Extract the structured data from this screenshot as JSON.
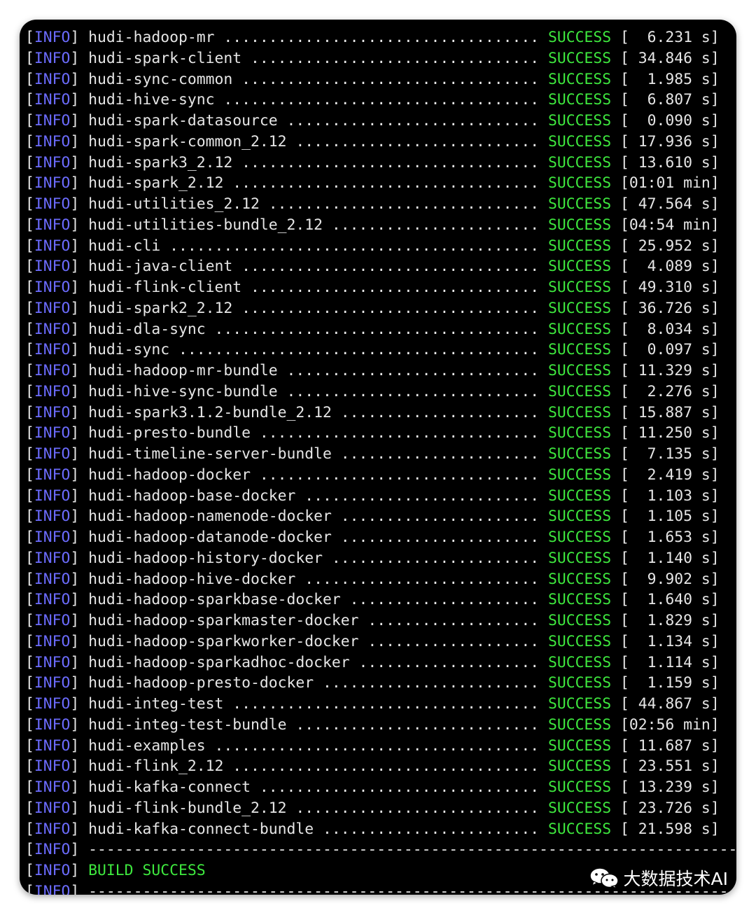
{
  "log": {
    "tag": "INFO",
    "status": "SUCCESS",
    "rows": [
      {
        "module": "hudi-hadoop-mr",
        "time": "  6.231 s"
      },
      {
        "module": "hudi-spark-client",
        "time": " 34.846 s"
      },
      {
        "module": "hudi-sync-common",
        "time": "  1.985 s"
      },
      {
        "module": "hudi-hive-sync",
        "time": "  6.807 s"
      },
      {
        "module": "hudi-spark-datasource",
        "time": "  0.090 s"
      },
      {
        "module": "hudi-spark-common_2.12",
        "time": " 17.936 s"
      },
      {
        "module": "hudi-spark3_2.12",
        "time": " 13.610 s"
      },
      {
        "module": "hudi-spark_2.12",
        "time": "01:01 min"
      },
      {
        "module": "hudi-utilities_2.12",
        "time": " 47.564 s"
      },
      {
        "module": "hudi-utilities-bundle_2.12",
        "time": "04:54 min"
      },
      {
        "module": "hudi-cli",
        "time": " 25.952 s"
      },
      {
        "module": "hudi-java-client",
        "time": "  4.089 s"
      },
      {
        "module": "hudi-flink-client",
        "time": " 49.310 s"
      },
      {
        "module": "hudi-spark2_2.12",
        "time": " 36.726 s"
      },
      {
        "module": "hudi-dla-sync",
        "time": "  8.034 s"
      },
      {
        "module": "hudi-sync",
        "time": "  0.097 s"
      },
      {
        "module": "hudi-hadoop-mr-bundle",
        "time": " 11.329 s"
      },
      {
        "module": "hudi-hive-sync-bundle",
        "time": "  2.276 s"
      },
      {
        "module": "hudi-spark3.1.2-bundle_2.12",
        "time": " 15.887 s"
      },
      {
        "module": "hudi-presto-bundle",
        "time": " 11.250 s"
      },
      {
        "module": "hudi-timeline-server-bundle",
        "time": "  7.135 s"
      },
      {
        "module": "hudi-hadoop-docker",
        "time": "  2.419 s"
      },
      {
        "module": "hudi-hadoop-base-docker",
        "time": "  1.103 s"
      },
      {
        "module": "hudi-hadoop-namenode-docker",
        "time": "  1.105 s"
      },
      {
        "module": "hudi-hadoop-datanode-docker",
        "time": "  1.653 s"
      },
      {
        "module": "hudi-hadoop-history-docker",
        "time": "  1.140 s"
      },
      {
        "module": "hudi-hadoop-hive-docker",
        "time": "  9.902 s"
      },
      {
        "module": "hudi-hadoop-sparkbase-docker",
        "time": "  1.640 s"
      },
      {
        "module": "hudi-hadoop-sparkmaster-docker",
        "time": "  1.829 s"
      },
      {
        "module": "hudi-hadoop-sparkworker-docker",
        "time": "  1.134 s"
      },
      {
        "module": "hudi-hadoop-sparkadhoc-docker",
        "time": "  1.114 s"
      },
      {
        "module": "hudi-hadoop-presto-docker",
        "time": "  1.159 s"
      },
      {
        "module": "hudi-integ-test",
        "time": " 44.867 s"
      },
      {
        "module": "hudi-integ-test-bundle",
        "time": "02:56 min"
      },
      {
        "module": "hudi-examples",
        "time": " 11.687 s"
      },
      {
        "module": "hudi-flink_2.12",
        "time": " 23.551 s"
      },
      {
        "module": "hudi-kafka-connect",
        "time": " 13.239 s"
      },
      {
        "module": "hudi-flink-bundle_2.12",
        "time": " 23.726 s"
      },
      {
        "module": "hudi-kafka-connect-bundle",
        "time": " 21.598 s"
      }
    ],
    "separator": "------------------------------------------------------------------------",
    "build_result": "BUILD SUCCESS"
  },
  "watermark": {
    "text": "大数据技术AI",
    "icon": "wechat-icon"
  },
  "colors": {
    "background": "#000000",
    "info": "#6c6cff",
    "success": "#3ee83e",
    "text": "#e6e6e6"
  }
}
